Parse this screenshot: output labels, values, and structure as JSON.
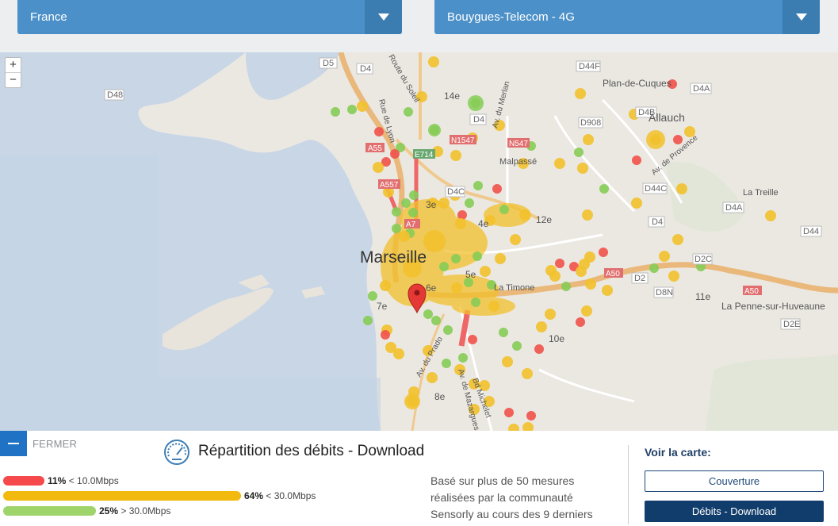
{
  "header": {
    "country_select": "France",
    "operator_select": "Bouygues-Telecom - 4G"
  },
  "map": {
    "zoom_in": "+",
    "zoom_out": "−",
    "labels": {
      "city": "Marseille",
      "d5": "D5",
      "d4": "D4",
      "d48": "D48",
      "d44f": "D44F",
      "d4a": "D4A",
      "d4b": "D4B",
      "d908": "D908",
      "d4_2": "D4",
      "d4c": "D4C",
      "d44c": "D44C",
      "d4a2": "D4A",
      "d4_3": "D4",
      "d44": "D44",
      "d2c": "D2C",
      "d2": "D2",
      "d8n": "D8N",
      "d2e": "D2E",
      "a55": "A55",
      "a557": "A557",
      "e714": "E714",
      "n1547": "N1547",
      "n547": "N547",
      "a7": "A7",
      "a50": "A50",
      "a50b": "A50",
      "plan_de_cuques": "Plan-de-Cuques",
      "allauch": "Allauch",
      "la_treille": "La Treille",
      "la_penne": "La Penne-sur-Huveaune",
      "malpasse": "Malpassé",
      "la_timone": "La Timone",
      "arr14": "14e",
      "arr3": "3e",
      "arr4": "4e",
      "arr12": "12e",
      "arr5": "5e",
      "arr6": "6e",
      "arr7": "7e",
      "arr10": "10e",
      "arr11": "11e",
      "arr8": "8e",
      "rue_de_lyon": "Rue de Lyon",
      "route_du_sol": "Route du Soleil",
      "av_merlan": "Av. du Merlan",
      "av_provence": "Av. de Provence",
      "av_prado": "Av. du Prado",
      "bd_michelet": "Bd Michelet",
      "av_mazargues": "Av. de Mazargues"
    },
    "legend_colors": {
      "slow": "#f0524a",
      "medium": "#f2c12c",
      "fast": "#86cc55"
    }
  },
  "panel": {
    "close_label": "FERMER",
    "title": "Répartition des débits - Download",
    "bars": [
      {
        "percent": "11%",
        "range": "< 10.0Mbps",
        "value": 11,
        "color": "#f5494b"
      },
      {
        "percent": "64%",
        "range": "< 30.0Mbps",
        "value": 64,
        "color": "#f2b90f"
      },
      {
        "percent": "25%",
        "range": "> 30.0Mbps",
        "value": 25,
        "color": "#9fd46b"
      }
    ],
    "note": "Basé sur plus de 50 mesures réalisées par la communauté Sensorly au cours des 9 derniers",
    "voir_label": "Voir la carte:",
    "btn_coverage": "Couverture",
    "btn_download": "Débits - Download"
  }
}
